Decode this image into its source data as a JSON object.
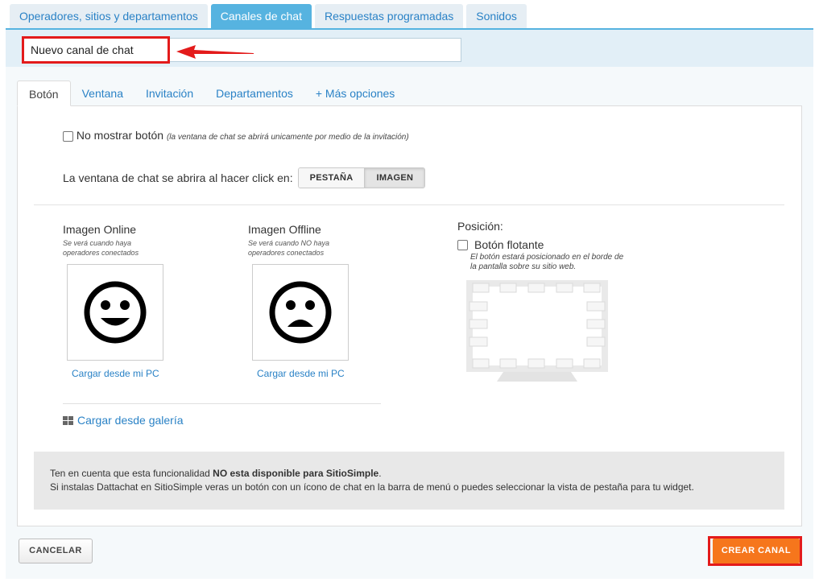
{
  "top_tabs": [
    {
      "label": "Operadores, sitios y departamentos",
      "active": false
    },
    {
      "label": "Canales de chat",
      "active": true
    },
    {
      "label": "Respuestas programadas",
      "active": false
    },
    {
      "label": "Sonidos",
      "active": false
    }
  ],
  "channel_name": {
    "value": "Nuevo canal de chat"
  },
  "sub_tabs": [
    {
      "label": "Botón",
      "active": true
    },
    {
      "label": "Ventana",
      "active": false
    },
    {
      "label": "Invitación",
      "active": false
    },
    {
      "label": "Departamentos",
      "active": false
    },
    {
      "label": "+ Más opciones",
      "active": false
    }
  ],
  "boton": {
    "hide_button": {
      "label": "No mostrar botón",
      "hint": "(la ventana de chat se abrirá unicamente por medio de la invitación)",
      "checked": false
    },
    "open_on": {
      "label": "La ventana de chat se abrira al hacer click en:",
      "options": [
        "PESTAÑA",
        "IMAGEN"
      ],
      "selected": "IMAGEN"
    },
    "online": {
      "title": "Imagen Online",
      "subtitle": "Se verá cuando haya operadores conectados",
      "upload": "Cargar desde mi PC",
      "icon": "happy-face-icon"
    },
    "offline": {
      "title": "Imagen Offline",
      "subtitle": "Se verá cuando NO haya operadores conectados",
      "upload": "Cargar desde mi PC",
      "icon": "sad-face-icon"
    },
    "gallery": {
      "label": "Cargar desde galería",
      "icon": "grid-icon"
    },
    "position": {
      "title": "Posición:",
      "floating_label": "Botón flotante",
      "floating_checked": false,
      "floating_note": "El botón estará posicionado en el borde de la pantalla sobre su sitio web."
    },
    "notice": {
      "line1_pre": "Ten en cuenta que esta funcionalidad ",
      "line1_bold": "NO esta disponible para SitioSimple",
      "line1_post": ".",
      "line2": "Si instalas Dattachat en SitioSimple veras un botón con un ícono de chat en la barra de menú o puedes seleccionar la vista de pestaña para tu widget."
    }
  },
  "actions": {
    "cancel": "CANCELAR",
    "create": "CREAR CANAL"
  },
  "colors": {
    "accent": "#56b3e0",
    "link": "#2a82c6",
    "create": "#f6761c",
    "highlight": "#e31b1b"
  }
}
